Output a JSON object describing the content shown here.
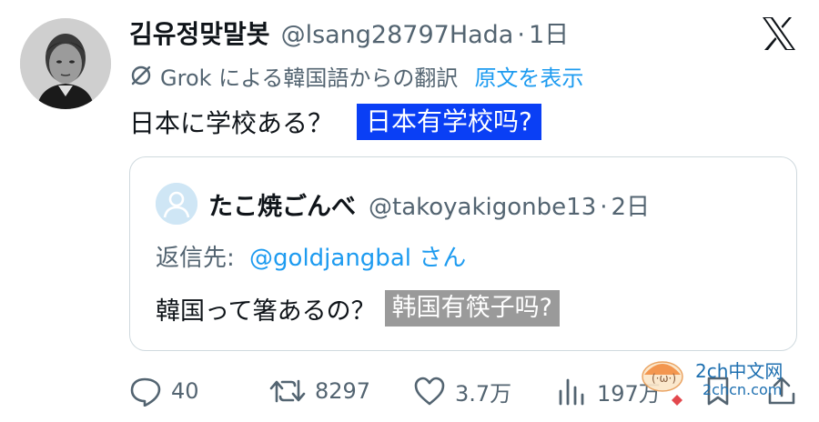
{
  "tweet": {
    "author_name": "김유정맞말봇",
    "handle": "@lsang28797Hada",
    "separator": "·",
    "time": "1日",
    "grok_label": "Grok による韓国語からの翻訳",
    "show_original": "原文を表示",
    "text": "日本に学校ある？",
    "translation": "日本有学校吗?"
  },
  "quote": {
    "author_name": "たこ焼ごんべ",
    "handle": "@takoyakigonbe13",
    "separator": "·",
    "time": "2日",
    "reply_label": "返信先:",
    "reply_user": "@goldjangbal さん",
    "text": "韓国って箸あるの？",
    "translation": "韩国有筷子吗?"
  },
  "actions": {
    "reply_count": "40",
    "retweet_count": "8297",
    "like_count": "3.7万",
    "view_count": "197万"
  },
  "watermark": {
    "line1": "2ch中文网",
    "line2": "2chcn.com"
  },
  "icons": {
    "brand": "x-logo-icon",
    "translate": "grok-translate-icon",
    "reply": "reply-icon",
    "retweet": "retweet-icon",
    "like": "like-icon",
    "views": "views-icon",
    "bookmark": "bookmark-icon",
    "share": "share-icon"
  },
  "colors": {
    "link": "#1d9bf0",
    "muted": "#536471",
    "translation_highlight": "#0a3ff5",
    "quote_translation_highlight": "#9a9a9a"
  }
}
